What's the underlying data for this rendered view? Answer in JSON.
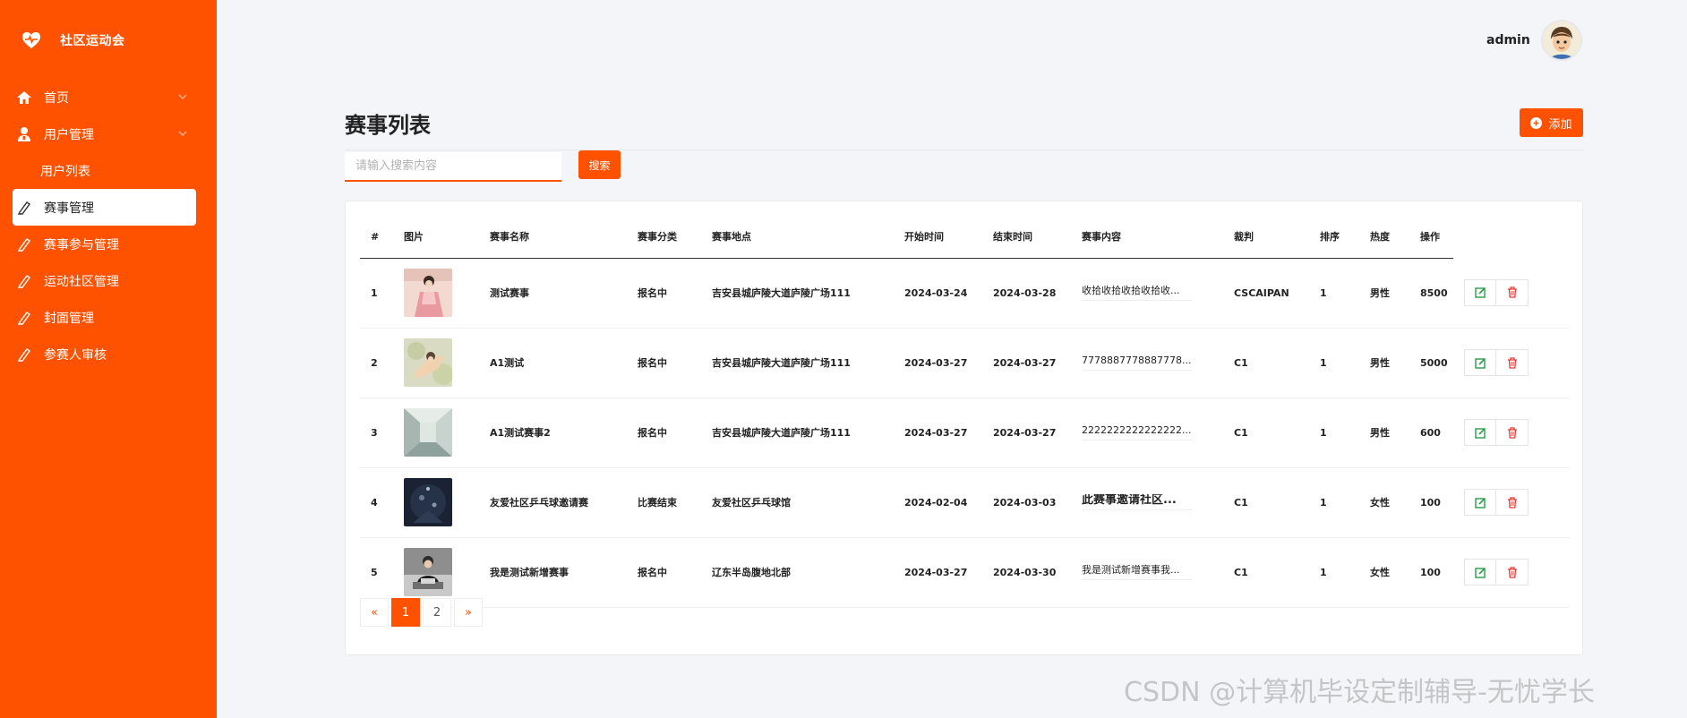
{
  "brand": {
    "name": "社区运动会",
    "icon": "heart-pulse-icon"
  },
  "sidebar": {
    "items": [
      {
        "label": "首页",
        "icon": "home-icon",
        "chevron": true
      },
      {
        "label": "用户管理",
        "icon": "user-icon",
        "chevron": true
      },
      {
        "label": "用户列表",
        "sub": true
      },
      {
        "label": "赛事管理",
        "icon": "pencil-icon",
        "active": true
      },
      {
        "label": "赛事参与管理",
        "icon": "pencil-icon"
      },
      {
        "label": "运动社区管理",
        "icon": "pencil-icon"
      },
      {
        "label": "封面管理",
        "icon": "pencil-icon"
      },
      {
        "label": "参赛人审核",
        "icon": "pencil-icon"
      }
    ]
  },
  "header": {
    "username": "admin"
  },
  "main": {
    "title": "赛事列表",
    "add_label": "添加",
    "search_placeholder": "请输入搜索内容",
    "search_label": "搜索"
  },
  "table": {
    "columns": [
      "#",
      "图片",
      "赛事名称",
      "赛事分类",
      "赛事地点",
      "开始时间",
      "结束时间",
      "赛事内容",
      "裁判",
      "排序",
      "热度",
      "操作"
    ],
    "rows": [
      {
        "index": "1",
        "name": "测试赛事",
        "category": "报名中",
        "location": "吉安县城庐陵大道庐陵广场111",
        "start": "2024-03-24",
        "end": "2024-03-28",
        "content": "收拾收拾收拾收拾收...",
        "referee": "CSCAIPAN",
        "sort": "1",
        "gender": "男性",
        "heat": "8500"
      },
      {
        "index": "2",
        "name": "A1测试",
        "category": "报名中",
        "location": "吉安县城庐陵大道庐陵广场111",
        "start": "2024-03-27",
        "end": "2024-03-27",
        "content": "7778887778887778...",
        "referee": "C1",
        "sort": "1",
        "gender": "男性",
        "heat": "5000"
      },
      {
        "index": "3",
        "name": "A1测试赛事2",
        "category": "报名中",
        "location": "吉安县城庐陵大道庐陵广场111",
        "start": "2024-03-27",
        "end": "2024-03-27",
        "content": "2222222222222222...",
        "referee": "C1",
        "sort": "1",
        "gender": "男性",
        "heat": "600"
      },
      {
        "index": "4",
        "name": "友爱社区乒乓球邀请赛",
        "category": "比赛结束",
        "location": "友爱社区乒乓球馆",
        "start": "2024-02-04",
        "end": "2024-03-03",
        "content": "此赛事邀请社区...",
        "referee": "C1",
        "sort": "1",
        "gender": "女性",
        "heat": "100"
      },
      {
        "index": "5",
        "name": "我是测试新增赛事",
        "category": "报名中",
        "location": "辽东半岛腹地北部",
        "start": "2024-03-27",
        "end": "2024-03-30",
        "content": "我是测试新增赛事我...",
        "referee": "C1",
        "sort": "1",
        "gender": "女性",
        "heat": "100"
      }
    ]
  },
  "pagination": {
    "prev": "«",
    "pages": [
      "1",
      "2"
    ],
    "current": "1",
    "next": "»"
  },
  "watermark": "CSDN @计算机毕设定制辅导-无忧学长",
  "colors": {
    "accent": "#ff5200",
    "background": "#f4f5f9"
  }
}
